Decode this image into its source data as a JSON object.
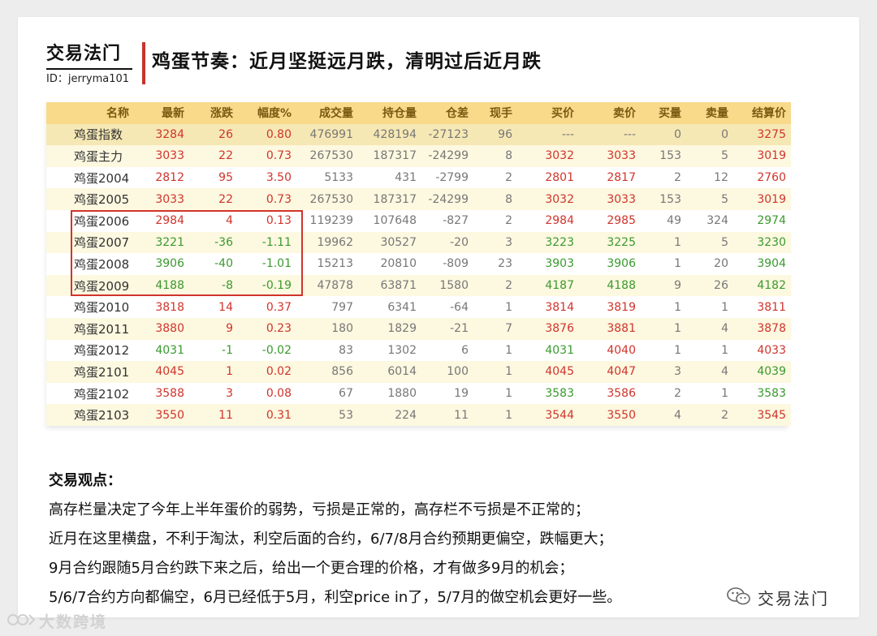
{
  "header": {
    "brand": "交易法门",
    "id_line": "ID：jerryma101",
    "title": "鸡蛋节奏：近月坚挺远月跌，清明过后近月跌"
  },
  "table": {
    "columns": [
      "名称",
      "最新",
      "涨跌",
      "幅度%",
      "成交量",
      "持仓量",
      "仓差",
      "现手",
      "买价",
      "卖价",
      "买量",
      "卖量",
      "结算价"
    ],
    "rows": [
      {
        "name": "鸡蛋指数",
        "last": "3284",
        "chg": "26",
        "pct": "0.80",
        "vol": "476991",
        "oi": "428194",
        "oi_chg": "-27123",
        "hand": "96",
        "bid": "---",
        "ask": "---",
        "bid_qty": "0",
        "ask_qty": "0",
        "settle": "3275",
        "dir": "up",
        "bid_c": "flat",
        "ask_c": "flat",
        "settle_c": "up"
      },
      {
        "name": "鸡蛋主力",
        "last": "3033",
        "chg": "22",
        "pct": "0.73",
        "vol": "267530",
        "oi": "187317",
        "oi_chg": "-24299",
        "hand": "8",
        "bid": "3032",
        "ask": "3033",
        "bid_qty": "153",
        "ask_qty": "5",
        "settle": "3019",
        "dir": "up",
        "bid_c": "up",
        "ask_c": "up",
        "settle_c": "up"
      },
      {
        "name": "鸡蛋2004",
        "last": "2812",
        "chg": "95",
        "pct": "3.50",
        "vol": "5133",
        "oi": "431",
        "oi_chg": "-2799",
        "hand": "2",
        "bid": "2801",
        "ask": "2817",
        "bid_qty": "2",
        "ask_qty": "12",
        "settle": "2760",
        "dir": "up",
        "bid_c": "up",
        "ask_c": "up",
        "settle_c": "up"
      },
      {
        "name": "鸡蛋2005",
        "last": "3033",
        "chg": "22",
        "pct": "0.73",
        "vol": "267530",
        "oi": "187317",
        "oi_chg": "-24299",
        "hand": "8",
        "bid": "3032",
        "ask": "3033",
        "bid_qty": "153",
        "ask_qty": "5",
        "settle": "3019",
        "dir": "up",
        "bid_c": "up",
        "ask_c": "up",
        "settle_c": "up"
      },
      {
        "name": "鸡蛋2006",
        "last": "2984",
        "chg": "4",
        "pct": "0.13",
        "vol": "119239",
        "oi": "107648",
        "oi_chg": "-827",
        "hand": "2",
        "bid": "2984",
        "ask": "2985",
        "bid_qty": "49",
        "ask_qty": "324",
        "settle": "2974",
        "dir": "up",
        "bid_c": "up",
        "ask_c": "up",
        "settle_c": "down"
      },
      {
        "name": "鸡蛋2007",
        "last": "3221",
        "chg": "-36",
        "pct": "-1.11",
        "vol": "19962",
        "oi": "30527",
        "oi_chg": "-20",
        "hand": "3",
        "bid": "3223",
        "ask": "3225",
        "bid_qty": "1",
        "ask_qty": "5",
        "settle": "3230",
        "dir": "down",
        "bid_c": "down",
        "ask_c": "down",
        "settle_c": "down"
      },
      {
        "name": "鸡蛋2008",
        "last": "3906",
        "chg": "-40",
        "pct": "-1.01",
        "vol": "15213",
        "oi": "20810",
        "oi_chg": "-809",
        "hand": "23",
        "bid": "3903",
        "ask": "3906",
        "bid_qty": "1",
        "ask_qty": "20",
        "settle": "3904",
        "dir": "down",
        "bid_c": "down",
        "ask_c": "down",
        "settle_c": "down"
      },
      {
        "name": "鸡蛋2009",
        "last": "4188",
        "chg": "-8",
        "pct": "-0.19",
        "vol": "47878",
        "oi": "63871",
        "oi_chg": "1580",
        "hand": "2",
        "bid": "4187",
        "ask": "4188",
        "bid_qty": "9",
        "ask_qty": "26",
        "settle": "4182",
        "dir": "down",
        "bid_c": "down",
        "ask_c": "down",
        "settle_c": "down"
      },
      {
        "name": "鸡蛋2010",
        "last": "3818",
        "chg": "14",
        "pct": "0.37",
        "vol": "797",
        "oi": "6341",
        "oi_chg": "-64",
        "hand": "1",
        "bid": "3814",
        "ask": "3819",
        "bid_qty": "1",
        "ask_qty": "1",
        "settle": "3811",
        "dir": "up",
        "bid_c": "up",
        "ask_c": "up",
        "settle_c": "up"
      },
      {
        "name": "鸡蛋2011",
        "last": "3880",
        "chg": "9",
        "pct": "0.23",
        "vol": "180",
        "oi": "1829",
        "oi_chg": "-21",
        "hand": "7",
        "bid": "3876",
        "ask": "3881",
        "bid_qty": "1",
        "ask_qty": "4",
        "settle": "3878",
        "dir": "up",
        "bid_c": "up",
        "ask_c": "up",
        "settle_c": "up"
      },
      {
        "name": "鸡蛋2012",
        "last": "4031",
        "chg": "-1",
        "pct": "-0.02",
        "vol": "83",
        "oi": "1302",
        "oi_chg": "6",
        "hand": "1",
        "bid": "4031",
        "ask": "4040",
        "bid_qty": "1",
        "ask_qty": "1",
        "settle": "4033",
        "dir": "down",
        "bid_c": "down",
        "ask_c": "up",
        "settle_c": "up"
      },
      {
        "name": "鸡蛋2101",
        "last": "4045",
        "chg": "1",
        "pct": "0.02",
        "vol": "856",
        "oi": "6014",
        "oi_chg": "100",
        "hand": "1",
        "bid": "4045",
        "ask": "4047",
        "bid_qty": "3",
        "ask_qty": "4",
        "settle": "4039",
        "dir": "up",
        "bid_c": "up",
        "ask_c": "up",
        "settle_c": "down"
      },
      {
        "name": "鸡蛋2102",
        "last": "3588",
        "chg": "3",
        "pct": "0.08",
        "vol": "67",
        "oi": "1880",
        "oi_chg": "19",
        "hand": "1",
        "bid": "3583",
        "ask": "3586",
        "bid_qty": "2",
        "ask_qty": "1",
        "settle": "3583",
        "dir": "up",
        "bid_c": "down",
        "ask_c": "up",
        "settle_c": "down"
      },
      {
        "name": "鸡蛋2103",
        "last": "3550",
        "chg": "11",
        "pct": "0.31",
        "vol": "53",
        "oi": "224",
        "oi_chg": "11",
        "hand": "1",
        "bid": "3544",
        "ask": "3550",
        "bid_qty": "4",
        "ask_qty": "2",
        "settle": "3545",
        "dir": "up",
        "bid_c": "up",
        "ask_c": "up",
        "settle_c": "up"
      }
    ]
  },
  "view": {
    "title": "交易观点：",
    "lines": [
      "高存栏量决定了今年上半年蛋价的弱势，亏损是正常的，高存栏不亏损是不正常的；",
      "近月在这里横盘，不利于淘汰，利空后面的合约，6/7/8月合约预期更偏空，跌幅更大；",
      "9月合约跟随5月合约跌下来之后，给出一个更合理的价格，才有做多9月的机会；",
      "5/6/7合约方向都偏空，6月已经低于5月，利空price in了，5/7月的做空机会更好一些。"
    ]
  },
  "footer": {
    "wechat_name": "交易法门",
    "watermark": "大数跨境"
  },
  "colors": {
    "up": "#d0342c",
    "down": "#3a9a2e",
    "header_bg": "#f9d98a",
    "highlight": "#d0342c"
  }
}
